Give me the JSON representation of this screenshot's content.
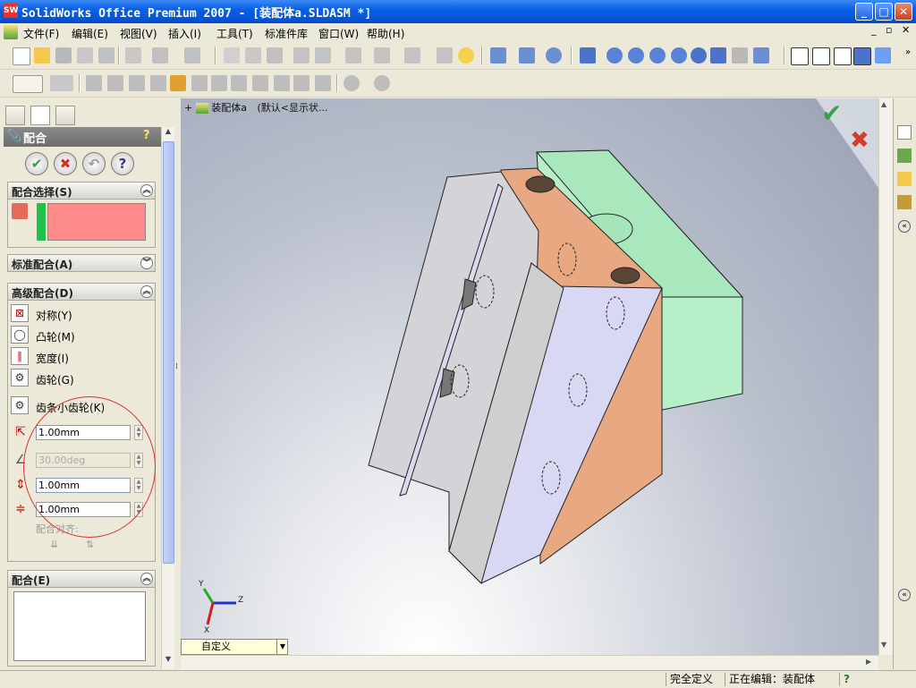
{
  "window": {
    "title": "SolidWorks Office Premium 2007 - [装配体a.SLDASM *]"
  },
  "menu": {
    "items": [
      "文件(F)",
      "编辑(E)",
      "视图(V)",
      "插入(I)",
      "工具(T)",
      "标准件库",
      "窗口(W)",
      "帮助(H)"
    ]
  },
  "panel": {
    "header": "配合",
    "sections": {
      "selection": "配合选择(S)",
      "standard": "标准配合(A)",
      "advanced": "高级配合(D)",
      "mates": "配合(E)"
    },
    "advanced_items": {
      "symmetric": "对称(Y)",
      "cam": "凸轮(M)",
      "width": "宽度(I)",
      "gear": "齿轮(G)",
      "rack": "齿条小齿轮(K)"
    },
    "fields": {
      "distance": "1.00mm",
      "angle": "30.00deg",
      "max": "1.00mm",
      "min": "1.00mm"
    },
    "alignment_label": "配合对齐:"
  },
  "viewport": {
    "breadcrumb_name": "装配体a",
    "breadcrumb_config": "(默认<显示状...",
    "config_dropdown": "自定义",
    "triad": {
      "x": "X",
      "y": "Y",
      "z": "Z"
    }
  },
  "status": {
    "left": "完全定义",
    "right": "正在编辑：装配体"
  },
  "colors": {
    "accent": "#0a5fe6",
    "selection_box": "#ff8a8a",
    "ok_green": "#2ea043",
    "cancel_red": "#d93025"
  }
}
